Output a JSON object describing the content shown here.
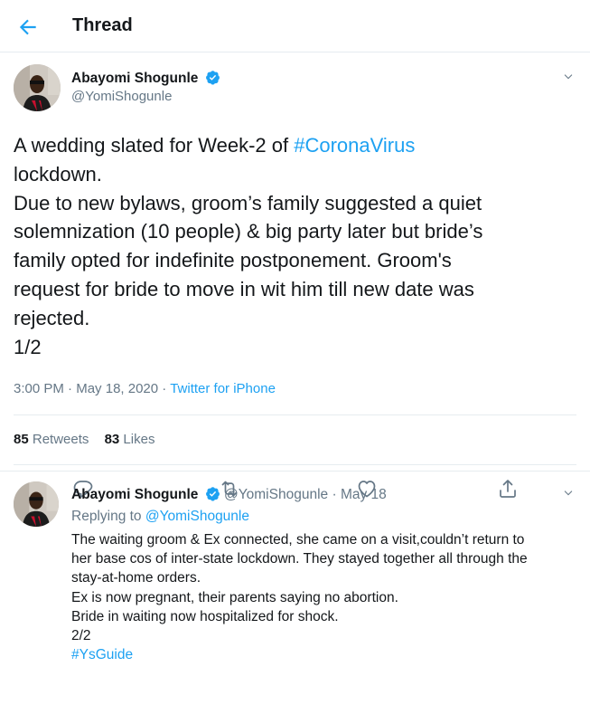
{
  "header": {
    "title": "Thread"
  },
  "main_tweet": {
    "author_name": "Abayomi Shogunle",
    "author_handle": "@YomiShogunle",
    "text_lines": [
      {
        "before": "A wedding slated for Week-2 of ",
        "hashtag": "#CoronaVirus"
      },
      "lockdown.",
      "Due to new bylaws, groom’s family suggested a quiet",
      "solemnization (10 people) & big party later but bride’s",
      "family opted for indefinite postponement. Groom's",
      "request for bride to move in wit him till new date was",
      "rejected.",
      "1/2"
    ],
    "time": "3:00 PM",
    "separator": "·",
    "date": "May 18, 2020",
    "source": "Twitter for iPhone",
    "retweets_count": "85",
    "retweets_label": "Retweets",
    "likes_count": "83",
    "likes_label": "Likes"
  },
  "reply_tweet": {
    "author_name": "Abayomi Shogunle",
    "author_handle": "@YomiShogunle",
    "separator": "·",
    "date": "May 18",
    "replying_label": "Replying to",
    "replying_handle": "@YomiShogunle",
    "text_lines": [
      "The waiting groom & Ex connected, she came on a visit,couldn’t return to",
      "her base cos of inter-state lockdown. They stayed together all through the",
      "stay-at-home orders.",
      "Ex is now pregnant, their parents saying no abortion.",
      "Bride in waiting now hospitalized for shock.",
      "2/2"
    ],
    "hashtag": "#YsGuide"
  },
  "icons": {
    "back": "arrow-left",
    "verified": "verified-badge",
    "caret": "chevron-down",
    "reply": "speech-bubble",
    "retweet": "retweet-arrows",
    "like": "heart",
    "share": "share-upload"
  },
  "colors": {
    "accent": "#1da1f2",
    "text": "#14171a",
    "muted": "#657786",
    "divider": "#e6ecf0"
  }
}
